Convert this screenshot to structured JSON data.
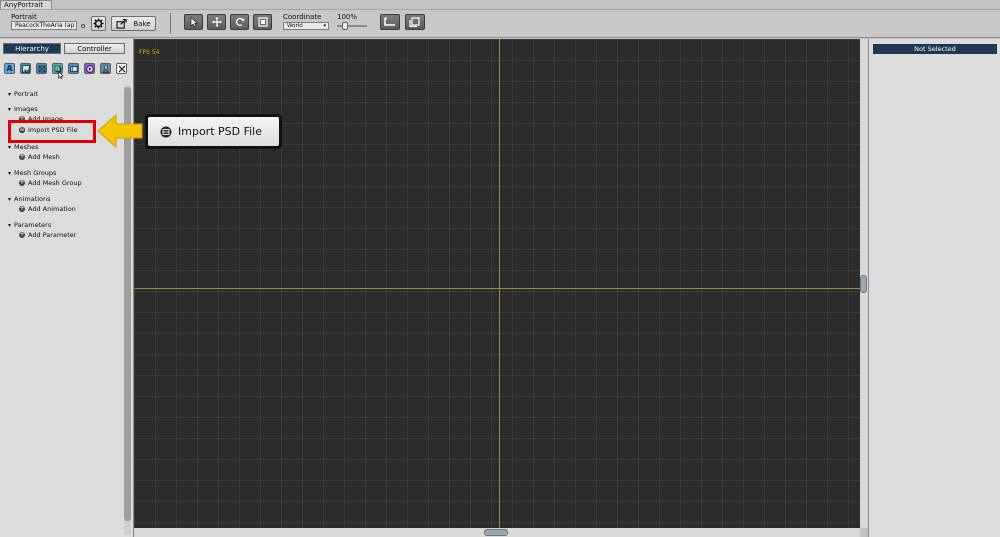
{
  "window": {
    "tab_title": "AnyPortrait"
  },
  "toolbar": {
    "portrait_label": "Portrait",
    "portrait_value": "PeacockTheAria (ap",
    "portrait_suffix": "o",
    "bake_label": "Bake",
    "coordinate_label": "Coordinate",
    "coordinate_value": "World",
    "zoom_label": "100%",
    "tools": [
      "select-arrow-icon",
      "move-icon",
      "rotate-icon",
      "scale-icon"
    ]
  },
  "left_panel": {
    "tabs": [
      {
        "label": "Hierarchy",
        "active": true
      },
      {
        "label": "Controller",
        "active": false
      }
    ],
    "tool_icons": [
      "text-icon",
      "image-icon",
      "mesh-icon",
      "mesh-group-icon",
      "animation-icon",
      "play-icon",
      "person-icon",
      "close-box-icon"
    ],
    "tree": {
      "portrait": "Portrait",
      "images": "Images",
      "add_image": "Add Image",
      "import_psd": "Import PSD File",
      "meshes": "Meshes",
      "add_mesh": "Add Mesh",
      "mesh_groups": "Mesh Groups",
      "add_mesh_group": "Add Mesh Group",
      "animations": "Animations",
      "add_animation": "Add Animation",
      "parameters": "Parameters",
      "add_parameter": "Add Parameter"
    }
  },
  "callout": {
    "label": "Import PSD File",
    "icon": "psd-icon",
    "arrow_color": "#f5c400",
    "highlight_color": "#e00000"
  },
  "canvas": {
    "fps_text": "FPS 54",
    "axis_color": "#8f8f2e",
    "fps_color": "#c8b400",
    "background": "#2c2c2c"
  },
  "right_panel": {
    "header": "Not Selected"
  }
}
